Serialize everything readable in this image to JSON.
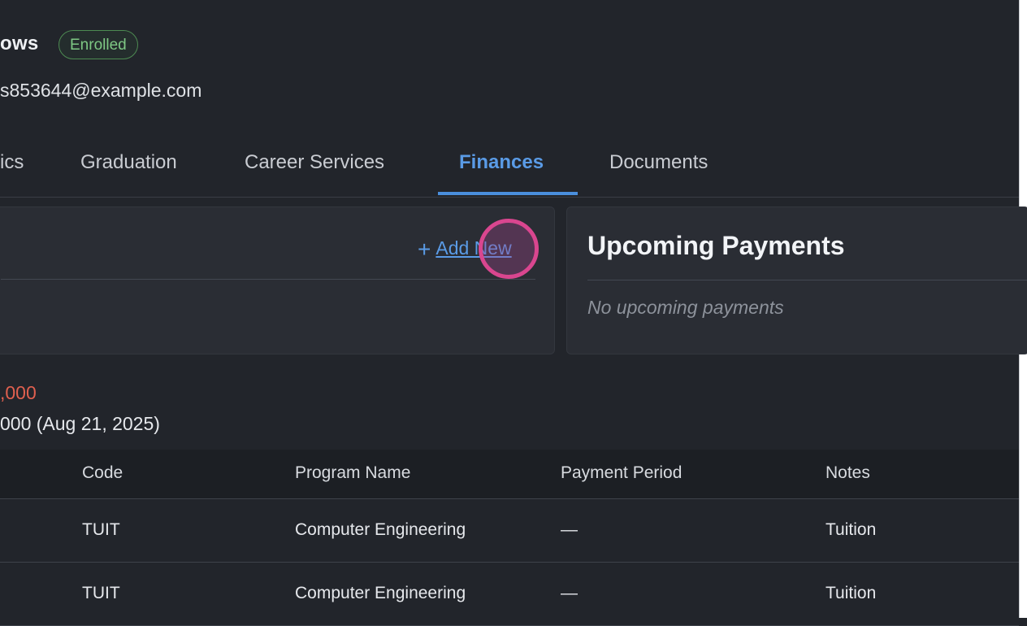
{
  "student": {
    "name_fragment": "ows",
    "status_badge": "Enrolled",
    "email_fragment": "s853644@example.com"
  },
  "tabs": [
    {
      "label": "ics",
      "active": false
    },
    {
      "label": "Graduation",
      "active": false
    },
    {
      "label": "Career Services",
      "active": false
    },
    {
      "label": "Finances",
      "active": true
    },
    {
      "label": "Documents",
      "active": false
    }
  ],
  "left_card": {
    "add_icon": "plus-icon",
    "add_label": "Add New"
  },
  "upcoming": {
    "title": "Upcoming Payments",
    "empty_text": "No upcoming payments"
  },
  "balance": {
    "amount_fragment": ",000",
    "next_fragment": "000  (Aug 21, 2025)"
  },
  "table": {
    "headers": [
      "Code",
      "Program Name",
      "Payment Period",
      "Notes"
    ],
    "rows": [
      [
        "TUIT",
        "Computer Engineering",
        "—",
        "Tuition"
      ],
      [
        "TUIT",
        "Computer Engineering",
        "—",
        "Tuition"
      ]
    ]
  },
  "colors": {
    "accent": "#4a8fdd",
    "enrolled_green": "#7ec784",
    "balance_red": "#e0604f",
    "background": "#22252b",
    "cursor_highlight": "#d9468f"
  }
}
